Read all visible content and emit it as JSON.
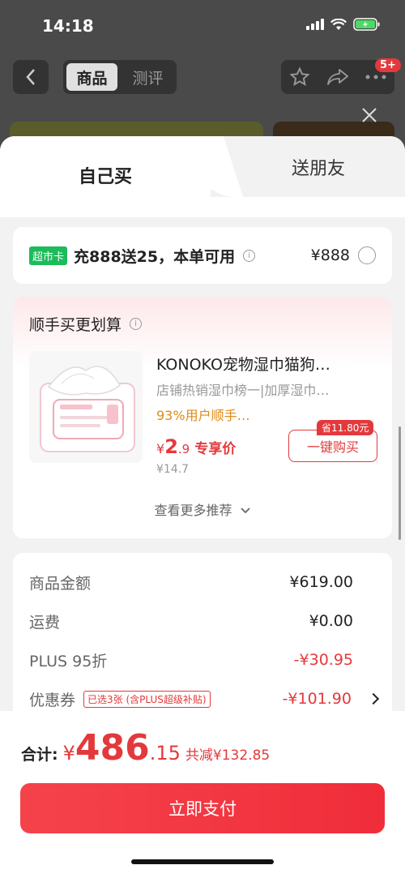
{
  "status": {
    "time": "14:18"
  },
  "nav": {
    "tabs": [
      "商品",
      "测评"
    ],
    "badge": "5+"
  },
  "sheet": {
    "tabs": {
      "self": "自己买",
      "friend": "送朋友"
    },
    "supermarket": {
      "tag": "超市卡",
      "text": "充888送25，本单可用",
      "price": "¥888"
    },
    "extra": {
      "title": "顺手买更划算",
      "product": {
        "name": "KONOKO宠物湿巾猫狗…",
        "subtitle": "店铺热销湿巾榜一|加厚湿巾…",
        "rate": "93%用户顺手…",
        "price_symbol": "¥",
        "price_int": "2",
        "price_dec": ".9",
        "price_label": "专享价",
        "original_price": "¥14.7",
        "save_tag": "省11.80元",
        "buy_label": "一键购买"
      },
      "more": "查看更多推荐"
    },
    "summary": {
      "rows": [
        {
          "label": "商品金额",
          "value": "¥619.00"
        },
        {
          "label": "运费",
          "value": "¥0.00"
        },
        {
          "label": "PLUS 95折",
          "value": "-¥30.95"
        },
        {
          "label": "优惠券",
          "tag": "已选3张 (含PLUS超级补贴)",
          "value": "-¥101.90"
        }
      ]
    }
  },
  "footer": {
    "total_label": "合计:",
    "total_symbol": "¥",
    "total_int": "486",
    "total_dec": ".15",
    "total_save": "共减¥132.85",
    "pay_label": "立即支付"
  },
  "colors": {
    "accent": "#e4393c",
    "supermarket_tag": "#1dbb5a",
    "rate": "#e08a17"
  }
}
